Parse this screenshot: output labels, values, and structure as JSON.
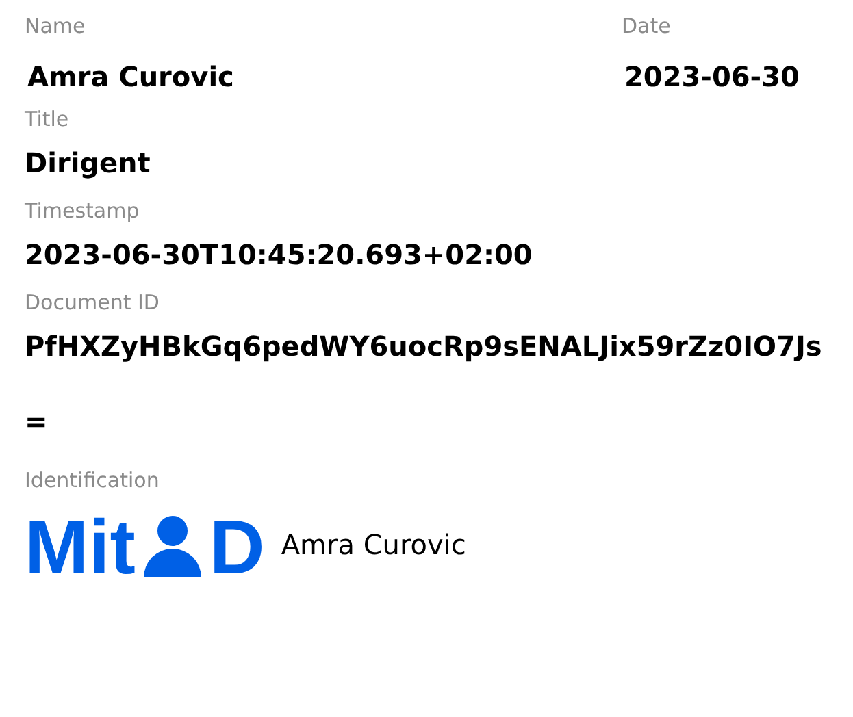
{
  "header": [
    {
      "label": "Name",
      "value": "Amra Curovic"
    },
    {
      "label": "Date",
      "value": "2023-06-30"
    }
  ],
  "fields": [
    {
      "label": "Title",
      "value": "Dirigent"
    },
    {
      "label": "Timestamp",
      "value": "2023-06-30T10:45:20.693+02:00"
    },
    {
      "label": "Document ID",
      "value": "PfHXZyHBkGq6pedWY6uocRp9sENALJix59rZz0IO7Js="
    }
  ],
  "identification": {
    "label": "Identification",
    "logo_prefix": "Mit",
    "logo_suffix": "D",
    "name": "Amra Curovic"
  }
}
